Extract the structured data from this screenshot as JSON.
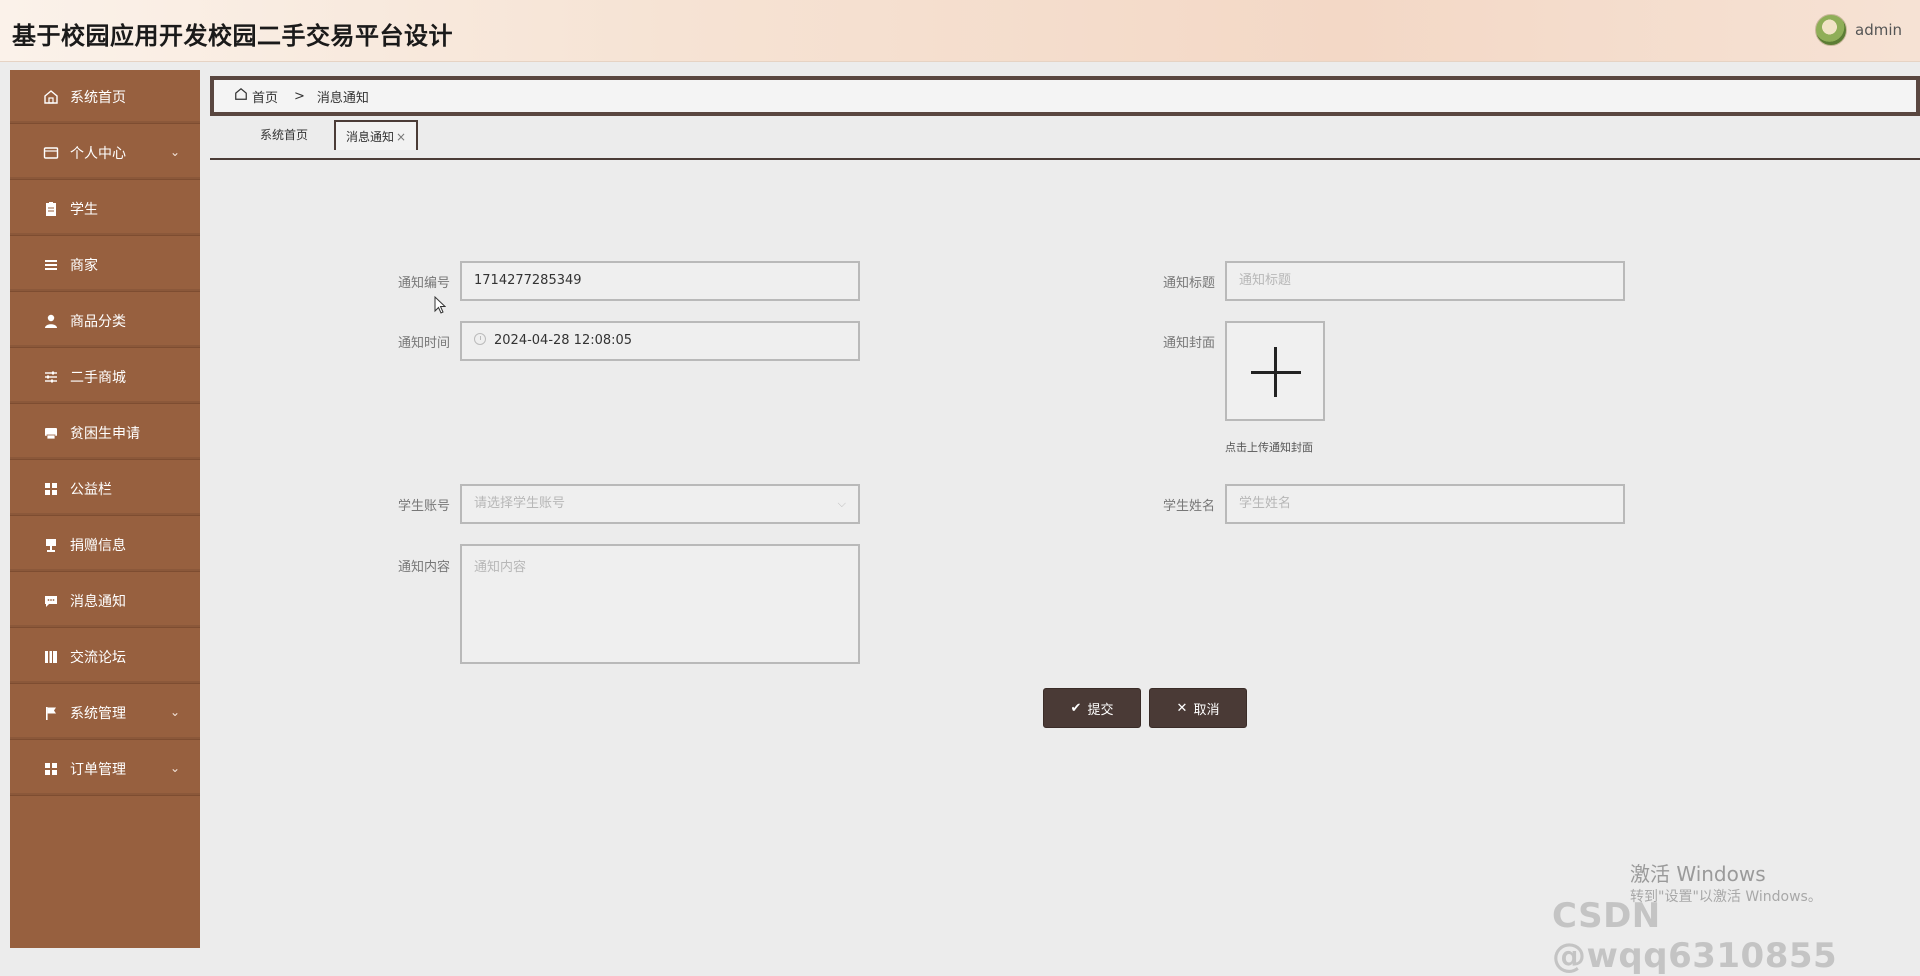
{
  "header": {
    "title": "基于校园应用开发校园二手交易平台设计",
    "username": "admin"
  },
  "sidebar": {
    "items": [
      {
        "label": "系统首页",
        "icon": "home-icon"
      },
      {
        "label": "个人中心",
        "icon": "wallet-icon",
        "expandable": true
      },
      {
        "label": "学生",
        "icon": "clipboard-icon"
      },
      {
        "label": "商家",
        "icon": "list-icon"
      },
      {
        "label": "商品分类",
        "icon": "user-icon"
      },
      {
        "label": "二手商城",
        "icon": "sliders-icon"
      },
      {
        "label": "贫困生申请",
        "icon": "printer-icon"
      },
      {
        "label": "公益栏",
        "icon": "grid-icon"
      },
      {
        "label": "捐赠信息",
        "icon": "stamp-icon"
      },
      {
        "label": "消息通知",
        "icon": "chat-icon"
      },
      {
        "label": "交流论坛",
        "icon": "book-icon"
      },
      {
        "label": "系统管理",
        "icon": "flag-icon",
        "expandable": true
      },
      {
        "label": "订单管理",
        "icon": "grid-icon",
        "expandable": true
      }
    ]
  },
  "breadcrumb": {
    "home": "首页",
    "separator": ">",
    "current": "消息通知"
  },
  "tabs": {
    "home": "系统首页",
    "active": "消息通知",
    "close": "×"
  },
  "form": {
    "notice_no": {
      "label": "通知编号",
      "value": "1714277285349"
    },
    "notice_title": {
      "label": "通知标题",
      "placeholder": "通知标题"
    },
    "notice_time": {
      "label": "通知时间",
      "value": "2024-04-28 12:08:05"
    },
    "notice_cover": {
      "label": "通知封面",
      "hint": "点击上传通知封面"
    },
    "student_account": {
      "label": "学生账号",
      "placeholder": "请选择学生账号"
    },
    "student_name": {
      "label": "学生姓名",
      "placeholder": "学生姓名"
    },
    "notice_content": {
      "label": "通知内容",
      "placeholder": "通知内容"
    }
  },
  "buttons": {
    "submit": "提交",
    "cancel": "取消"
  },
  "overlay": {
    "activate_title": "激活 Windows",
    "activate_sub": "转到\"设置\"以激活 Windows。",
    "csdn": "CSDN @wqq6310855"
  },
  "colors": {
    "sidebar_bg": "#97603f",
    "button_bg": "#4a3a36",
    "breadcrumb_border": "#5a4740"
  }
}
